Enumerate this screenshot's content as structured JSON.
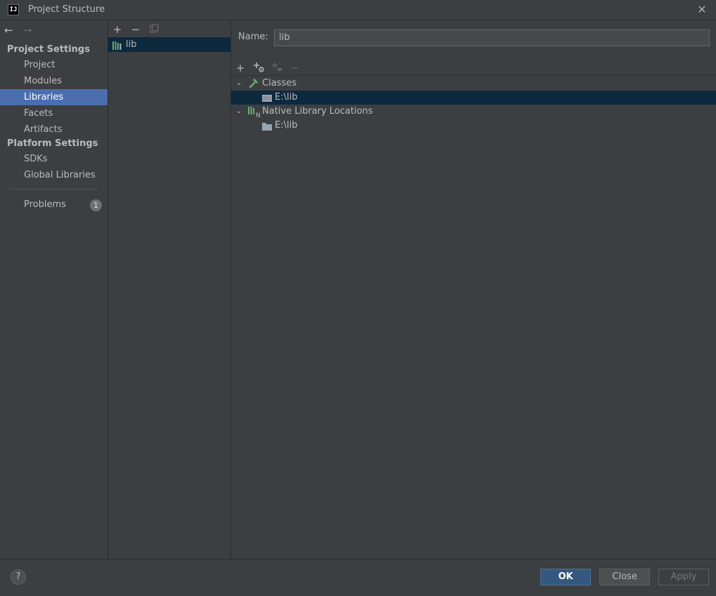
{
  "window": {
    "title": "Project Structure",
    "app_icon": "intellij-icon",
    "app_icon_text": "IJ",
    "close_icon": "close-icon"
  },
  "sidebar": {
    "back_icon": "arrow-left-icon",
    "forward_icon": "arrow-right-icon",
    "project_settings_header": "Project Settings",
    "project_settings_items": [
      {
        "label": "Project",
        "selected": false
      },
      {
        "label": "Modules",
        "selected": false
      },
      {
        "label": "Libraries",
        "selected": true
      },
      {
        "label": "Facets",
        "selected": false
      },
      {
        "label": "Artifacts",
        "selected": false
      }
    ],
    "platform_settings_header": "Platform Settings",
    "platform_settings_items": [
      {
        "label": "SDKs",
        "selected": false
      },
      {
        "label": "Global Libraries",
        "selected": false
      }
    ],
    "problems": {
      "label": "Problems",
      "count": "1"
    }
  },
  "libraries_panel": {
    "toolbar": {
      "add_icon": "plus-icon",
      "remove_icon": "minus-icon",
      "copy_icon": "copy-icon"
    },
    "items": [
      {
        "label": "lib",
        "icon": "library-icon",
        "selected": true
      }
    ]
  },
  "details": {
    "name_label": "Name:",
    "name_value": "lib",
    "toolbar": {
      "add_icon": "plus-icon",
      "add_special_icon": "plus-settings-icon",
      "add_disabled_icon": "plus-disabled-icon",
      "remove_icon": "minus-icon"
    },
    "tree": [
      {
        "label": "Classes",
        "icon": "hammer-icon",
        "expanded": true,
        "children": [
          {
            "label": "E:\\lib",
            "icon": "jar-folder-icon",
            "selected": true
          }
        ]
      },
      {
        "label": "Native Library Locations",
        "icon": "native-library-icon",
        "expanded": true,
        "children": [
          {
            "label": "E:\\lib",
            "icon": "folder-icon",
            "selected": false
          }
        ]
      }
    ]
  },
  "footer": {
    "help_label": "?",
    "ok_label": "OK",
    "close_label": "Close",
    "apply_label": "Apply"
  },
  "colors": {
    "background": "#3c3f41",
    "selection_accent": "#4b6eaf",
    "tree_selection": "#0d293e",
    "primary_button": "#365880",
    "library_icon_green": "#6aab73"
  }
}
